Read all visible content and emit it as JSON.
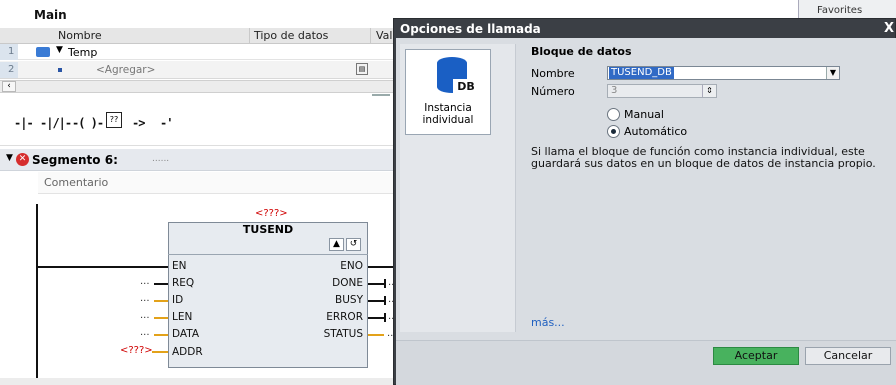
{
  "editor": {
    "block_name": "Main",
    "columns": {
      "name": "Nombre",
      "type": "Tipo de datos",
      "value": "Val"
    },
    "rows": [
      {
        "num": "1",
        "name": "Temp"
      },
      {
        "num": "2",
        "name": "<Agregar>"
      }
    ],
    "segment": {
      "label": "Segmento 6:",
      "placeholder": "......"
    },
    "comment": "Comentario",
    "block": {
      "instance": "<???>",
      "name": "TUSEND",
      "inputs": [
        "EN",
        "REQ",
        "ID",
        "LEN",
        "DATA",
        "ADDR"
      ],
      "outputs": [
        "ENO",
        "DONE",
        "BUSY",
        "ERROR",
        "STATUS"
      ],
      "input_values": [
        "",
        "...",
        "...",
        "...",
        "...",
        "<???>"
      ],
      "output_values": [
        "",
        "..",
        "..",
        "..",
        ".."
      ]
    },
    "toolbar": [
      "-|-",
      "-|/|-",
      "-( )-",
      "??",
      "->",
      "-'"
    ]
  },
  "favorites_tab": "Favorites",
  "dialog": {
    "title": "Opciones de llamada",
    "close": "X",
    "tile": {
      "badge": "DB",
      "label_line1": "Instancia",
      "label_line2": "individual"
    },
    "section": "Bloque de datos",
    "name_label": "Nombre",
    "name_value": "TUSEND_DB",
    "number_label": "Número",
    "number_value": "3",
    "radio_manual": "Manual",
    "radio_auto": "Automático",
    "info": "Si llama el bloque de función como instancia individual, este guardará sus datos en un bloque de datos de instancia propio.",
    "more": "más...",
    "ok": "Aceptar",
    "cancel": "Cancelar"
  },
  "colors": {
    "accent_ok": "#48b25e",
    "title_bar": "#3b3f45",
    "wire": "#e3a21a",
    "error": "#d00000"
  }
}
